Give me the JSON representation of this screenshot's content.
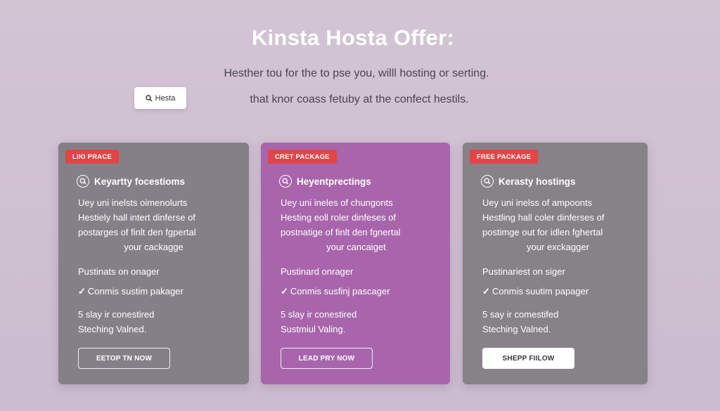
{
  "header": {
    "title": "Kinsta Hosta Offer:",
    "intro_line_1": "Hesther tou for the to pse you, willl hosting or serting.",
    "intro_line_2": "that knor coass fetuby at the confect hestils."
  },
  "search_chip": {
    "label": "Hesta",
    "icon": "search-icon"
  },
  "cards": [
    {
      "badge": "LIЮ PRACE",
      "heading": "Keyartty focestioms",
      "icon": "search-circle-icon",
      "desc": [
        "Uey uni inelsts oimenolurts",
        "Hestiely hall intert dinferse of",
        "postarges of finlt den fgpertal",
        "your cackagge"
      ],
      "feature_1": "Pustinats on onager",
      "feature_2": "Conmis sustim pakager",
      "feature_3_line_1": "5 slay ir conestired",
      "feature_3_line_2": "Steching Valned.",
      "cta": "EETOP TN NOW",
      "color": "#858087"
    },
    {
      "badge": "CRET PACKAGE",
      "heading": "Heyentprectings",
      "icon": "search-circle-icon",
      "desc": [
        "Uey uni ineles of chungonts",
        "Hesting eoll roler dinfeses of",
        "postnatige of finlt den fgnertal",
        "your cancaiget"
      ],
      "feature_1": "Pustinard onrager",
      "feature_2": "Conmis susfinj pascager",
      "feature_3_line_1": "5 slay ir conestired",
      "feature_3_line_2": "Sustmiul Valing.",
      "cta": "LEAD PRY NOW",
      "color": "#a865ac"
    },
    {
      "badge": "FREE PACKAGE",
      "heading": "Kerasty hostings",
      "icon": "search-circle-icon",
      "desc": [
        "Uey uni inelss of ampoonts",
        "Hestling hall coler dinferses of",
        "postimge out for idlen fghertal",
        "your exckagger"
      ],
      "feature_1": "Pustinariest on siger",
      "feature_2": "Conmis suutim papager",
      "feature_3_line_1": "5 say ir comestifed",
      "feature_3_line_2": "Steching Valned.",
      "cta": "SHEPP FIILOW",
      "color": "#878188"
    }
  ],
  "checkmark_glyph": "✓"
}
